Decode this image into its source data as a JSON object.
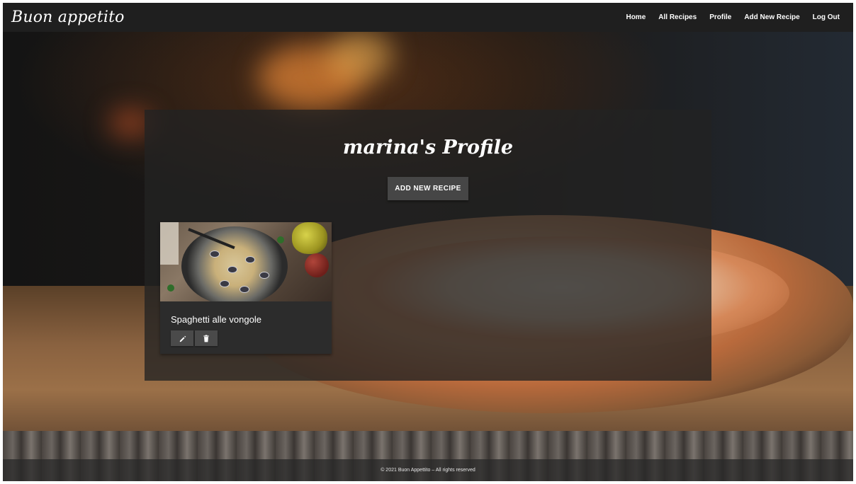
{
  "navbar": {
    "brand": "Buon appetito",
    "links": [
      "Home",
      "All Recipes",
      "Profile",
      "Add New Recipe",
      "Log Out"
    ]
  },
  "profile": {
    "title": "marina's Profile",
    "add_button_label": "ADD NEW RECIPE"
  },
  "recipes": [
    {
      "name": "Spaghetti alle vongole",
      "image_icon": "spaghetti-vongole-photo",
      "actions": [
        "pencil-icon",
        "trash-icon"
      ]
    }
  ],
  "footer": {
    "text": "© 2021 Buon Appettito – All rights reserved"
  }
}
